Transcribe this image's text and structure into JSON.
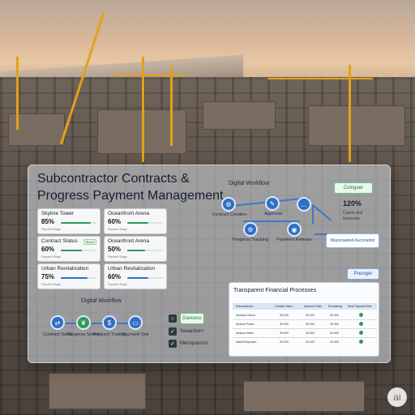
{
  "title": "Subcontractor Contracts & Progress Payment Management",
  "cards": [
    {
      "name": "Skyline Tower",
      "percent": "85%",
      "progress": 0.85,
      "sub": "Payment Stage"
    },
    {
      "name": "Oceanfront Arena",
      "percent": "60%",
      "progress": 0.6,
      "sub": "Payment Stage"
    },
    {
      "name": "Contract Status",
      "percent": "60%",
      "progress": 0.6,
      "sub": "Payment Stage",
      "badge": "Bleed"
    },
    {
      "name": "Oceanfront Arena",
      "percent": "50%",
      "progress": 0.5,
      "sub": "Payment Stage"
    },
    {
      "name": "Urban Revitalization",
      "percent": "75%",
      "progress": 0.75,
      "sub": "Payment Stage"
    },
    {
      "name": "Urban Revitalization",
      "percent": "60%",
      "progress": 0.6,
      "sub": "Payment Stage"
    }
  ],
  "workflow_top": {
    "title": "Digital Workflow",
    "nodes": [
      {
        "label": "Contract Creation",
        "icon": "gear-icon"
      },
      {
        "label": "Approval",
        "icon": "pen-icon"
      },
      {
        "label": "Progress Tracking",
        "icon": "gear-icon"
      },
      {
        "label": "Payment Release",
        "icon": "chat-icon"
      }
    ]
  },
  "workflow_bottom": {
    "title": "Digital Workflow",
    "nodes": [
      {
        "label": "Contract Soliat",
        "icon": "link-icon"
      },
      {
        "label": "Progress Soried",
        "icon": "leaf-icon"
      },
      {
        "label": "Progrect Trading",
        "icon": "dollar-icon"
      },
      {
        "label": "Paynwell Seti",
        "icon": "card-icon"
      }
    ]
  },
  "buttons": {
    "configure": "Coingaer",
    "pointer": "Pounger",
    "automated": "Wayonwated Auconation"
  },
  "stat": {
    "value": "120%",
    "caption": "Cearts and Ianmeats"
  },
  "checklist": [
    {
      "label": "Danoess",
      "state": "pending"
    },
    {
      "label": "Seaanbom",
      "state": "done"
    },
    {
      "label": "Menopanson",
      "state": "done"
    }
  ],
  "table": {
    "title": "Transparent Financial Processes",
    "headers": [
      "Subcontactor",
      "Cectant Value",
      "Aumeet Patid",
      "Remaining",
      "Nest Payment Dat"
    ],
    "rows": [
      [
        "Aneasur Nonur",
        "25 000",
        "35 000",
        "25 000"
      ],
      [
        "Alcarvk Pulise",
        "35 000",
        "35 000",
        "35 000"
      ],
      [
        "Anasou Wate",
        "30 600",
        "30 600",
        "30 600"
      ],
      [
        "Nanel Ruyowan",
        "25 000",
        "25 000",
        "25 000"
      ]
    ]
  },
  "watermark": "ai",
  "colors": {
    "accent": "#2f6fc4",
    "success": "#2f9a5a",
    "panel": "#c8cdd4"
  }
}
